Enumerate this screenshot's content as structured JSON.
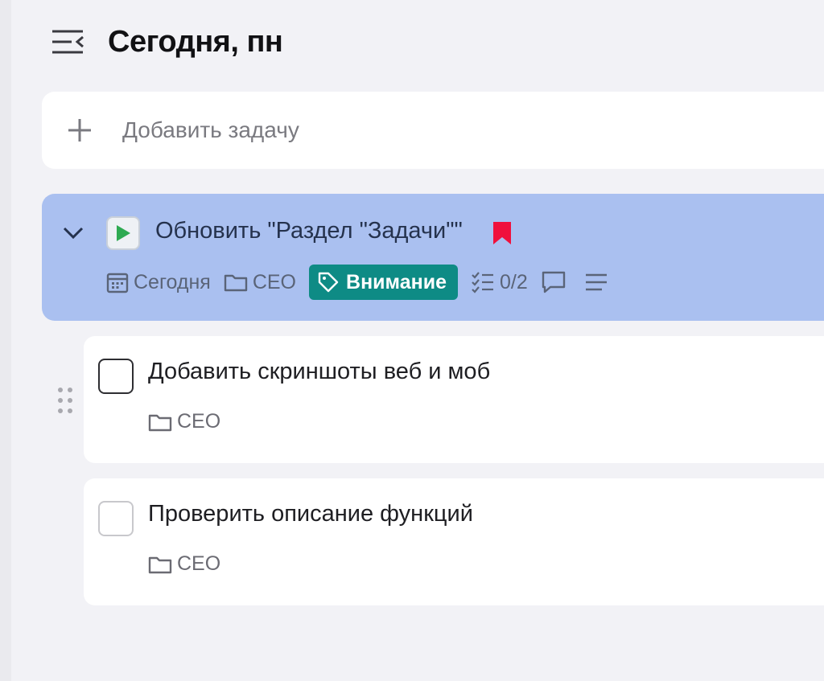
{
  "header": {
    "title": "Сегодня, пн",
    "menu_icon": "menu-collapse-icon"
  },
  "add_task": {
    "placeholder": "Добавить задачу",
    "icon": "plus-icon"
  },
  "parent_task": {
    "title": "Обновить \"Раздел \"Задачи\"\"",
    "status_icon": "play-icon",
    "bookmark_color": "#f0103c",
    "highlight_color": "#aac0f0",
    "meta": {
      "date": "Сегодня",
      "project": "CEO",
      "tag": "Внимание",
      "tag_color": "#0e8b85",
      "subtasks_progress": "0/2"
    }
  },
  "subtasks": [
    {
      "title": "Добавить скриншоты веб и моб",
      "project": "CEO"
    },
    {
      "title": "Проверить описание функций",
      "project": "CEO"
    }
  ]
}
